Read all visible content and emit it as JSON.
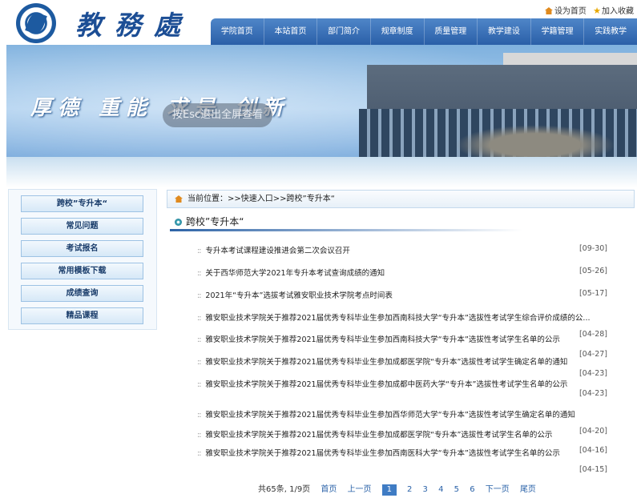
{
  "header": {
    "site_name": "教務處",
    "set_home": "设为首页",
    "add_favorite": "加入收藏",
    "nav": [
      "学院首页",
      "本站首页",
      "部门简介",
      "规章制度",
      "质量管理",
      "教学建设",
      "学籍管理",
      "实践教学"
    ]
  },
  "banner": {
    "motto": "厚德 重能 求是 创新",
    "esc_hint": "按Esc退出全屏查看"
  },
  "sidebar": {
    "items": [
      "跨校”专升本“",
      "常见问题",
      "考试报名",
      "常用模板下载",
      "成绩查询",
      "精品课程"
    ]
  },
  "breadcrumb": {
    "label": "当前位置：",
    "path": ">>快速入口>>跨校”专升本“"
  },
  "section": {
    "title": "跨校”专升本“"
  },
  "news": [
    {
      "title": "专升本考试课程建设推进会第二次会议召开",
      "date": "[09-30]"
    },
    {
      "title": "关于西华师范大学2021年专升本考试查询成绩的通知",
      "date": "[05-26]"
    },
    {
      "title": "2021年“专升本”选拔考试雅安职业技术学院考点时间表",
      "date": "[05-17]"
    },
    {
      "title": "雅安职业技术学院关于推荐2021届优秀专科毕业生参加西南科技大学“专升本”选拔性考试学生综合评价成绩的公...",
      "date": ""
    },
    {
      "title": "雅安职业技术学院关于推荐2021届优秀专科毕业生参加西南科技大学“专升本”选拔性考试学生名单的公示",
      "date": "[04-28]"
    },
    {
      "title": "雅安职业技术学院关于推荐2021届优秀专科毕业生参加成都医学院“专升本”选拔性考试学生确定名单的通知",
      "date": "[04-27]"
    },
    {
      "title": "雅安职业技术学院关于推荐2021届优秀专科毕业生参加成都中医药大学“专升本”选拔性考试学生名单的公示",
      "date": "[04-23]"
    },
    {
      "title": "雅安职业技术学院关于推荐2021届优秀专科毕业生参加西华师范大学“专升本”选拔性考试学生确定名单的通知",
      "date": "[04-23]"
    },
    {
      "title": "雅安职业技术学院关于推荐2021届优秀专科毕业生参加成都医学院“专升本”选拔性考试学生名单的公示",
      "date": "[04-20]"
    },
    {
      "title": "雅安职业技术学院关于推荐2021届优秀专科毕业生参加西南医科大学“专升本”选拔性考试学生名单的公示",
      "date": "[04-16]"
    },
    {
      "title": "",
      "date": "[04-15]"
    }
  ],
  "pager": {
    "summary": "共65条, 1/9页",
    "first": "首页",
    "prev": "上一页",
    "pages": [
      "1",
      "2",
      "3",
      "4",
      "5",
      "6"
    ],
    "current": "1",
    "next": "下一页",
    "last": "尾页"
  },
  "colors": {
    "nav": "#2a5fa8",
    "accent": "#1c4e95",
    "page_current": "#3f7cc4"
  }
}
